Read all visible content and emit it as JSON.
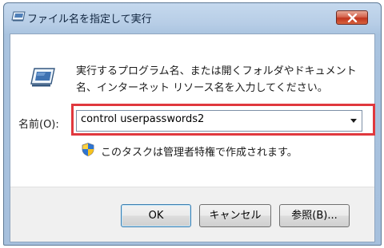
{
  "window": {
    "title": "ファイル名を指定して実行"
  },
  "dialog": {
    "description": "実行するプログラム名、または開くフォルダやドキュメント名、インターネット リソース名を入力してください。",
    "open_label": "名前(O):",
    "input_value": "control userpasswords2",
    "admin_note": "このタスクは管理者特権で作成されます。"
  },
  "buttons": {
    "ok": "OK",
    "cancel": "キャンセル",
    "browse": "参照(B)..."
  },
  "colors": {
    "highlight_box": "#e0383e",
    "title_bar": "#b7cde6"
  },
  "icons": [
    "run-app-icon",
    "close-icon",
    "chevron-down-icon",
    "uac-shield-icon"
  ]
}
